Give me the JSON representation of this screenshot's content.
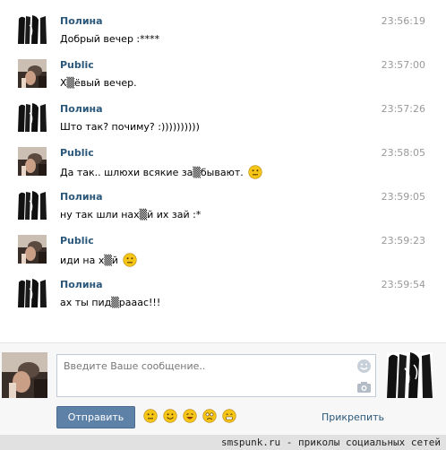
{
  "messages": [
    {
      "sender": "Полина",
      "time": "23:56:19",
      "text": "Добрый вечер :****",
      "avatar": "polina-avatar",
      "smile": false
    },
    {
      "sender": "Public",
      "time": "23:57:00",
      "text": "Х▒ёвый вечер.",
      "avatar": "public-avatar",
      "smile": false
    },
    {
      "sender": "Полина",
      "time": "23:57:26",
      "text": "Што так? почиму? :))))))))))",
      "avatar": "polina-avatar",
      "smile": false
    },
    {
      "sender": "Public",
      "time": "23:58:05",
      "text": "Да так.. шлюхи всякие за▒бывают.",
      "avatar": "public-avatar",
      "smile": true
    },
    {
      "sender": "Полина",
      "time": "23:59:05",
      "text": "ну так шли нах▒й их зай :*",
      "avatar": "polina-avatar",
      "smile": false
    },
    {
      "sender": "Public",
      "time": "23:59:23",
      "text": "иди на х▒й",
      "avatar": "public-avatar",
      "smile": true
    },
    {
      "sender": "Полина",
      "time": "23:59:54",
      "text": "ах ты пид▒раааc!!!",
      "avatar": "polina-avatar",
      "smile": false
    }
  ],
  "composer": {
    "placeholder": "Введите Ваше сообщение..",
    "value": "",
    "send_label": "Отправить",
    "attach_label": "Прикрепить",
    "quick_smiles": [
      "smile-icon",
      "happy-icon",
      "laugh-icon",
      "sad-icon",
      "grin-icon"
    ]
  },
  "footer": {
    "watermark": "smspunk.ru - приколы социальных сетей"
  },
  "colors": {
    "sender_name": "#2b587a",
    "time": "#999999",
    "send_button": "#5e81a8",
    "link": "#2b587a",
    "smile_yellow": "#f5c518"
  }
}
